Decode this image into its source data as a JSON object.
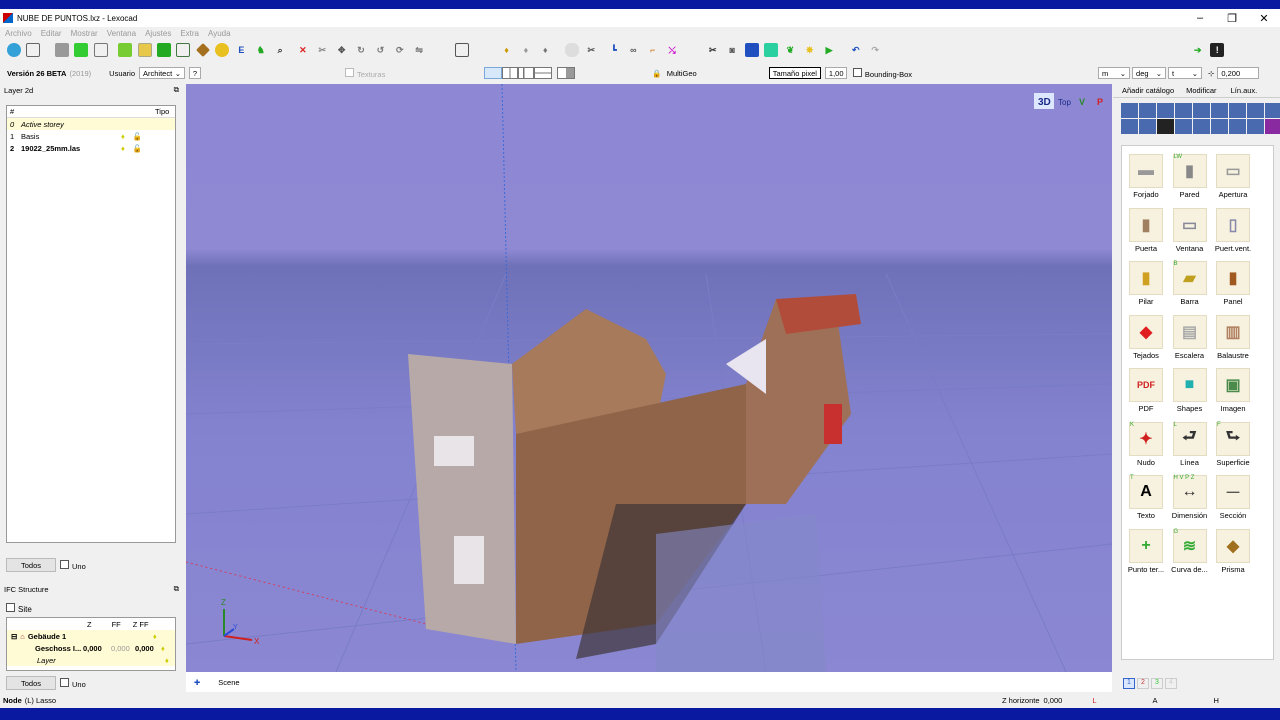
{
  "window": {
    "title": "NUBE DE PUNTOS.lxz - Lexocad",
    "minimize": "–",
    "maximize": "❐",
    "close": "✕"
  },
  "menu": [
    "Archivo",
    "Editar",
    "Mostrar",
    "Ventana",
    "Ajustes",
    "Extra",
    "Ayuda"
  ],
  "row2": {
    "version": "Versión 26 BETA",
    "year": "(2019)",
    "user_label": "Usuario",
    "user_value": "Architect",
    "help": "?",
    "texturas": "Texturas",
    "multigeo": "MultiGeo",
    "pixel_size_label": "Tamaño pixel",
    "pixel_size_value": "1,00",
    "bounding_box": "Bounding-Box",
    "unit_m": "m",
    "unit_deg": "deg",
    "unit_t": "t",
    "snap_value": "0,200"
  },
  "layer_panel": {
    "title": "Layer 2d",
    "col_hash": "#",
    "col_tipo": "Tipo",
    "rows": [
      {
        "n": "0",
        "name": "Active storey"
      },
      {
        "n": "1",
        "name": "Basis"
      },
      {
        "n": "2",
        "name": "19022_25mm.las"
      }
    ],
    "btn_all": "Todos",
    "chk_one": "Uno"
  },
  "ifc_panel": {
    "title": "IFC Structure",
    "site": "Site",
    "col_z": "Z",
    "col_ff": "FF",
    "col_zff": "Z FF",
    "building": "Gebäude 1",
    "floor": "Geschoss I...",
    "floor_z": "0,000",
    "floor_ff": "0,000",
    "floor_zff": "0,000",
    "layer": "Layer",
    "btn_all": "Todos",
    "chk_one": "Uno"
  },
  "viewport": {
    "views": [
      "3D",
      "Top",
      "V",
      "P"
    ],
    "axis_x": "X",
    "axis_y": "Y",
    "axis_z": "Z",
    "scene_tab": "Scene"
  },
  "right_panel": {
    "tabs": [
      "Añadir catálogo",
      "Modificar",
      "Lín.aux."
    ],
    "items": [
      {
        "label": "Forjado",
        "icon": "slab-icon",
        "tag": ""
      },
      {
        "label": "Pared",
        "icon": "wall-icon",
        "tag": "LW"
      },
      {
        "label": "Apertura",
        "icon": "opening-icon",
        "tag": ""
      },
      {
        "label": "Puerta",
        "icon": "door-icon",
        "tag": ""
      },
      {
        "label": "Ventana",
        "icon": "window-icon",
        "tag": ""
      },
      {
        "label": "Puert.vent.",
        "icon": "door-window-icon",
        "tag": ""
      },
      {
        "label": "Pilar",
        "icon": "column-icon",
        "tag": ""
      },
      {
        "label": "Barra",
        "icon": "beam-icon",
        "tag": "B"
      },
      {
        "label": "Panel",
        "icon": "panel-icon",
        "tag": ""
      },
      {
        "label": "Tejados",
        "icon": "roof-icon",
        "tag": ""
      },
      {
        "label": "Escalera",
        "icon": "stair-icon",
        "tag": ""
      },
      {
        "label": "Balaustre",
        "icon": "railing-icon",
        "tag": ""
      },
      {
        "label": "PDF",
        "icon": "pdf-icon",
        "tag": ""
      },
      {
        "label": "Shapes",
        "icon": "shapes-icon",
        "tag": ""
      },
      {
        "label": "Imagen",
        "icon": "image-icon",
        "tag": ""
      },
      {
        "label": "Nudo",
        "icon": "node-icon",
        "tag": "K"
      },
      {
        "label": "Línea",
        "icon": "line-icon",
        "tag": "L"
      },
      {
        "label": "Superficie",
        "icon": "surface-icon",
        "tag": "F"
      },
      {
        "label": "Texto",
        "icon": "text-icon",
        "tag": "T"
      },
      {
        "label": "Dimensión",
        "icon": "dimension-icon",
        "tag": "H V P Z"
      },
      {
        "label": "Sección",
        "icon": "section-icon",
        "tag": ""
      },
      {
        "label": "Punto ter...",
        "icon": "terrain-point-icon",
        "tag": ""
      },
      {
        "label": "Curva de...",
        "icon": "contour-icon",
        "tag": "G"
      },
      {
        "label": "Prisma",
        "icon": "prism-icon",
        "tag": ""
      }
    ],
    "pages": [
      "1",
      "2",
      "3",
      "4"
    ]
  },
  "status": {
    "mode": "Node",
    "mode_sub": "(L) Lasso",
    "z_label": "Z horizonte",
    "z_value": "0,000",
    "l": "L",
    "a": "A",
    "h": "H"
  },
  "colors": {
    "accent": "#0078d7",
    "viewport_sky": "#8e88d4",
    "taskbar": "#0a1aa0"
  }
}
